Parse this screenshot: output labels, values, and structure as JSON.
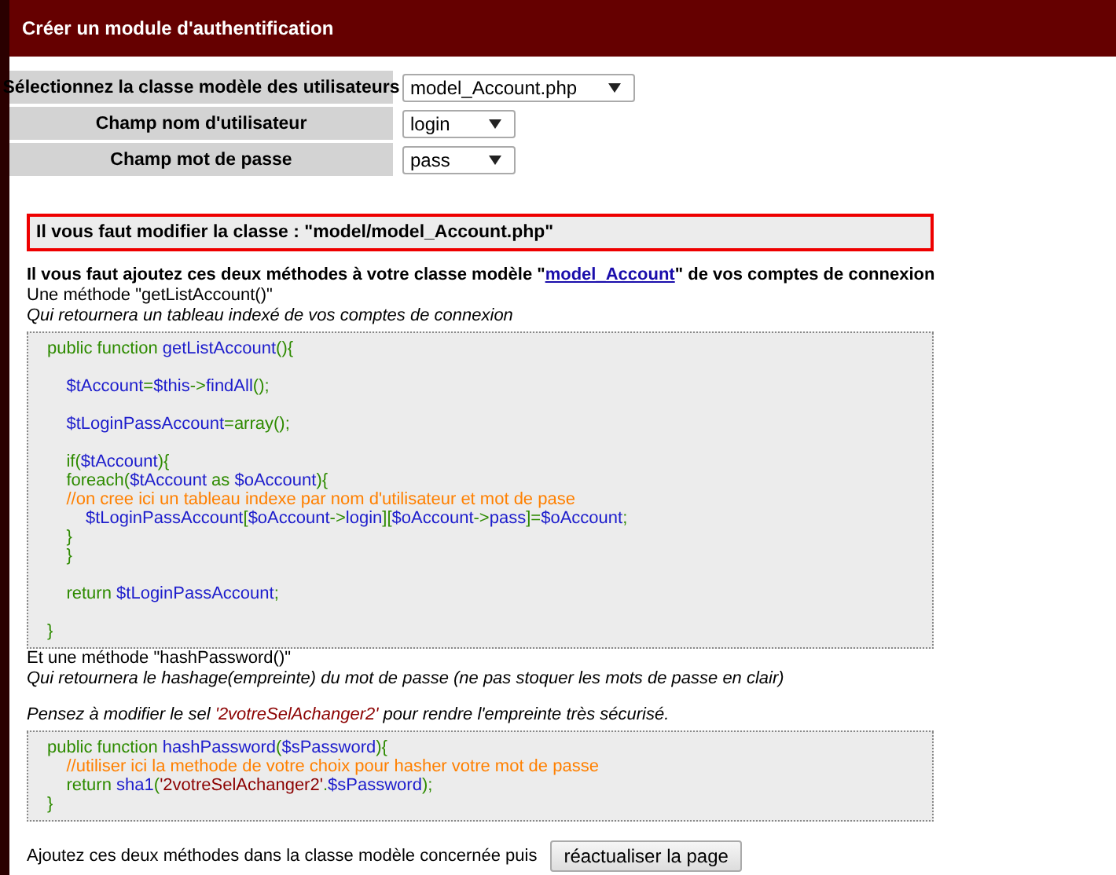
{
  "header": {
    "title": "Créer un module d'authentification"
  },
  "form": {
    "rows": [
      {
        "label": "Sélectionnez la classe modèle des utilisateurs",
        "value": "model_Account.php"
      },
      {
        "label": "Champ nom d'utilisateur",
        "value": "login"
      },
      {
        "label": "Champ mot de passe",
        "value": "pass"
      }
    ]
  },
  "notice": "Il vous faut modifier la classe : \"model/model_Account.php\"",
  "instruction": {
    "before": "Il vous faut ajoutez ces deux méthodes à votre classe modèle \"",
    "link": "model_Account",
    "after": "\" de vos comptes de connexion"
  },
  "method_1": {
    "title": "Une méthode \"getListAccount()\"",
    "description": "Qui retournera un tableau indexé de vos comptes de connexion"
  },
  "code_1": [
    {
      "kind": "code",
      "tokens": [
        {
          "kind": "plain",
          "text": "public function "
        },
        {
          "kind": "name",
          "text": "getListAccount"
        },
        {
          "kind": "plain",
          "text": "(){"
        }
      ]
    },
    {
      "kind": "blank"
    },
    {
      "kind": "code",
      "tokens": [
        {
          "kind": "name",
          "text": "    $tAccount"
        },
        {
          "kind": "plain",
          "text": "="
        },
        {
          "kind": "name",
          "text": "$this"
        },
        {
          "kind": "plain",
          "text": "->"
        },
        {
          "kind": "name",
          "text": "findAll"
        },
        {
          "kind": "plain",
          "text": "();"
        }
      ]
    },
    {
      "kind": "blank"
    },
    {
      "kind": "code",
      "tokens": [
        {
          "kind": "name",
          "text": "    $tLoginPassAccount"
        },
        {
          "kind": "plain",
          "text": "=array();"
        }
      ]
    },
    {
      "kind": "blank"
    },
    {
      "kind": "code",
      "tokens": [
        {
          "kind": "plain",
          "text": "    if("
        },
        {
          "kind": "name",
          "text": "$tAccount"
        },
        {
          "kind": "plain",
          "text": "){"
        }
      ]
    },
    {
      "kind": "code",
      "tokens": [
        {
          "kind": "plain",
          "text": "    foreach("
        },
        {
          "kind": "name",
          "text": "$tAccount"
        },
        {
          "kind": "plain",
          "text": " as "
        },
        {
          "kind": "name",
          "text": "$oAccount"
        },
        {
          "kind": "plain",
          "text": "){"
        }
      ]
    },
    {
      "kind": "code",
      "tokens": [
        {
          "kind": "comment",
          "text": "    //on cree ici un tableau indexe par nom d'utilisateur et mot de pase"
        }
      ]
    },
    {
      "kind": "code",
      "tokens": [
        {
          "kind": "name",
          "text": "        $tLoginPassAccount"
        },
        {
          "kind": "plain",
          "text": "["
        },
        {
          "kind": "name",
          "text": "$oAccount"
        },
        {
          "kind": "plain",
          "text": "->"
        },
        {
          "kind": "name",
          "text": "login"
        },
        {
          "kind": "plain",
          "text": "]["
        },
        {
          "kind": "name",
          "text": "$oAccount"
        },
        {
          "kind": "plain",
          "text": "->"
        },
        {
          "kind": "name",
          "text": "pass"
        },
        {
          "kind": "plain",
          "text": "]="
        },
        {
          "kind": "name",
          "text": "$oAccount"
        },
        {
          "kind": "plain",
          "text": ";"
        }
      ]
    },
    {
      "kind": "code",
      "tokens": [
        {
          "kind": "plain",
          "text": "    }"
        }
      ]
    },
    {
      "kind": "code",
      "tokens": [
        {
          "kind": "plain",
          "text": "    }"
        }
      ]
    },
    {
      "kind": "blank"
    },
    {
      "kind": "code",
      "tokens": [
        {
          "kind": "plain",
          "text": "    return "
        },
        {
          "kind": "name",
          "text": "$tLoginPassAccount"
        },
        {
          "kind": "plain",
          "text": ";"
        }
      ]
    },
    {
      "kind": "blank"
    },
    {
      "kind": "code",
      "tokens": [
        {
          "kind": "plain",
          "text": "}"
        }
      ]
    }
  ],
  "method_2": {
    "title": "Et une méthode \"hashPassword()\"",
    "description": "Qui retournera le hashage(empreinte) du mot de passe (ne pas stoquer les mots de passe en clair)"
  },
  "salt_note": {
    "before": "Pensez à modifier le sel ",
    "highlight": "'2votreSelAchanger2'",
    "after": " pour rendre l'empreinte très sécurisé."
  },
  "code_2": [
    {
      "kind": "code",
      "tokens": [
        {
          "kind": "plain",
          "text": "public function "
        },
        {
          "kind": "name",
          "text": "hashPassword"
        },
        {
          "kind": "plain",
          "text": "("
        },
        {
          "kind": "name",
          "text": "$sPassword"
        },
        {
          "kind": "plain",
          "text": "){"
        }
      ]
    },
    {
      "kind": "code",
      "tokens": [
        {
          "kind": "comment",
          "text": "    //utiliser ici la methode de votre choix pour hasher votre mot de passe"
        }
      ]
    },
    {
      "kind": "code",
      "tokens": [
        {
          "kind": "plain",
          "text": "    return "
        },
        {
          "kind": "name",
          "text": "sha1"
        },
        {
          "kind": "plain",
          "text": "("
        },
        {
          "kind": "string",
          "text": "'2votreSelAchanger2'"
        },
        {
          "kind": "plain",
          "text": "."
        },
        {
          "kind": "name",
          "text": "$sPassword"
        },
        {
          "kind": "plain",
          "text": ");"
        }
      ]
    },
    {
      "kind": "code",
      "tokens": [
        {
          "kind": "plain",
          "text": "}"
        }
      ]
    }
  ],
  "footer": {
    "text": "Ajoutez ces deux méthodes dans la classe modèle concernée puis",
    "button": "réactualiser la page"
  }
}
